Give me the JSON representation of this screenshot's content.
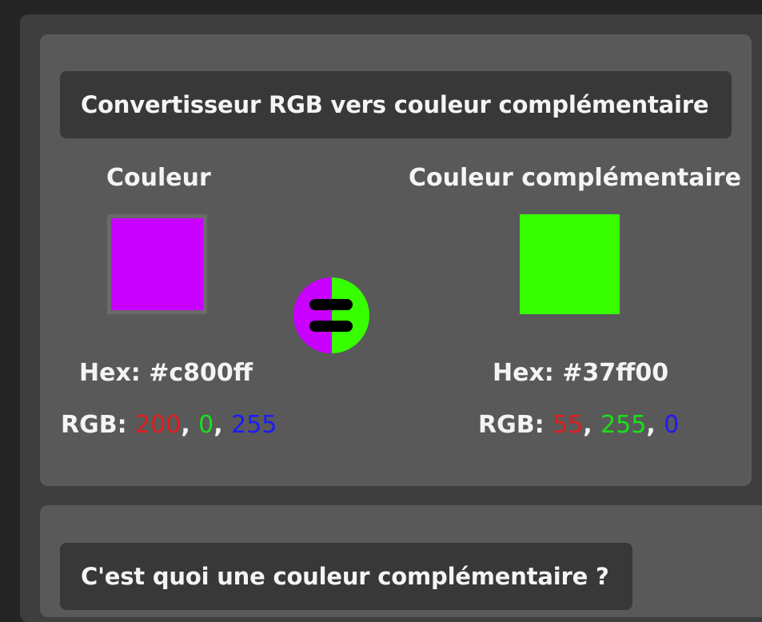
{
  "converter": {
    "title": "Convertisseur RGB vers couleur complémentaire",
    "original": {
      "heading": "Couleur",
      "color": "#c800ff",
      "hex_label": "Hex: #c800ff",
      "rgb_label": "RGB:",
      "r": "200",
      "g": "0",
      "b": "255",
      "sep": ","
    },
    "complement": {
      "heading": "Couleur complémentaire",
      "color": "#37ff00",
      "hex_label": "Hex: #37ff00",
      "rgb_label": "RGB:",
      "r": "55",
      "g": "255",
      "b": "0",
      "sep": ","
    },
    "equals_icon": "equals-icon"
  },
  "explanation": {
    "title": "C'est quoi une couleur complémentaire ?"
  },
  "colors": {
    "page_background": "#242424",
    "outer_panel": "#3e3e3e",
    "card": "#595959",
    "title_bar": "#383838",
    "red_value": "#e01b1b",
    "green_value": "#19e019",
    "blue_value": "#1b1bff"
  }
}
